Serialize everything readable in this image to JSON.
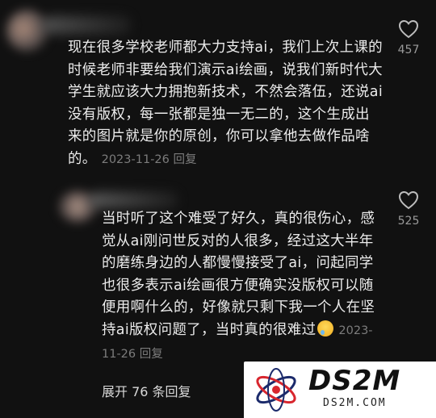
{
  "comments": [
    {
      "text": "现在很多学校老师都大力支持ai，我们上次上课的时候老师非要给我们演示ai绘画，说我们新时代大学生就应该大力拥抱新技术，不然会落伍，还说ai没有版权，每一张都是独一无二的，这个生成出来的图片就是你的原创，你可以拿他去做作品啥的。",
      "date": "2023-11-26",
      "reply": "回复",
      "likes": "457"
    },
    {
      "text": "当时听了这个难受了好久，真的很伤心，感觉从ai刚问世反对的人很多，经过这大半年的磨练身边的人都慢慢接受了ai，问起同学也很多表示ai绘画很方便确实没版权可以随便用啊什么的，好像就只剩下我一个人在坚持ai版权问题了，当时真的很难过",
      "date": "2023-11-26",
      "reply": "回复",
      "likes": "525"
    }
  ],
  "expand_label": "展开 76 条回复",
  "watermark": {
    "title": "DS2M",
    "subtitle": "DS2M.COM"
  },
  "icons": {
    "like": "heart-outline-icon",
    "emoji": "crying-face-emoji"
  }
}
